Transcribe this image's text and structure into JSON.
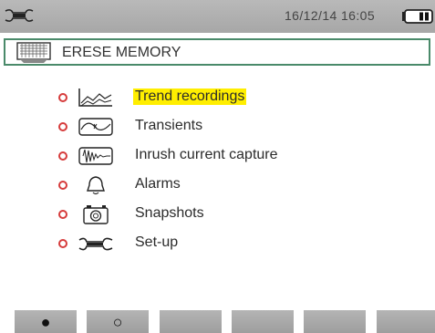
{
  "status_bar": {
    "setup_icon": "wrench-setup-icon",
    "datetime": "16/12/14  16:05",
    "battery_icon": "battery-icon"
  },
  "header": {
    "icon": "memory-grid-icon",
    "title": "ERESE MEMORY"
  },
  "menu": {
    "items": [
      {
        "label": "Trend recordings",
        "icon": "trend-icon",
        "selected": true
      },
      {
        "label": "Transients",
        "icon": "transients-icon",
        "selected": false
      },
      {
        "label": "Inrush current capture",
        "icon": "inrush-icon",
        "selected": false
      },
      {
        "label": "Alarms",
        "icon": "bell-icon",
        "selected": false
      },
      {
        "label": "Snapshots",
        "icon": "camera-icon",
        "selected": false
      },
      {
        "label": "Set-up",
        "icon": "wrench-icon",
        "selected": false
      }
    ]
  },
  "softkeys": [
    {
      "glyph": "●",
      "icon": "filled-circle-icon"
    },
    {
      "glyph": "○",
      "icon": "empty-circle-icon"
    },
    {
      "glyph": ""
    },
    {
      "glyph": ""
    },
    {
      "glyph": ""
    },
    {
      "glyph": ""
    }
  ],
  "colors": {
    "highlight": "#ffee00",
    "bullet": "#d63b3b",
    "frame": "#4a8a6a"
  }
}
